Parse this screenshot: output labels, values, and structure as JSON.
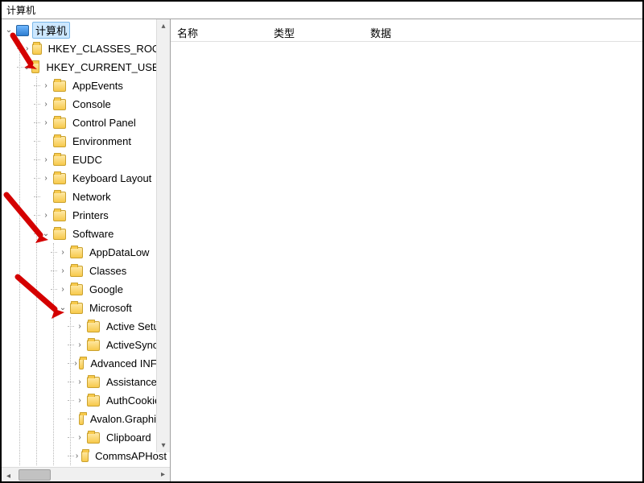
{
  "window": {
    "title": "计算机"
  },
  "list": {
    "columns": {
      "name": "名称",
      "type": "类型",
      "data": "数据"
    }
  },
  "tree": {
    "root": {
      "label": "计算机"
    },
    "hkcr": {
      "label": "HKEY_CLASSES_ROOT"
    },
    "hkcu": {
      "label": "HKEY_CURRENT_USER"
    },
    "hkcu_children": {
      "appevents": "AppEvents",
      "console": "Console",
      "control_panel": "Control Panel",
      "environment": "Environment",
      "eudc": "EUDC",
      "keyboard_layout": "Keyboard Layout",
      "network": "Network",
      "printers": "Printers",
      "software": "Software"
    },
    "software_children": {
      "appdatalow": "AppDataLow",
      "classes": "Classes",
      "google": "Google",
      "microsoft": "Microsoft"
    },
    "microsoft_children": {
      "active_setup": "Active Setup",
      "activesync": "ActiveSync",
      "advanced_inf_s": "Advanced INF S",
      "assistance": "Assistance",
      "authcookies": "AuthCookies",
      "avalon_graphics": "Avalon.Graphics",
      "clipboard": "Clipboard",
      "comms_ap_host": "CommsAPHost"
    }
  }
}
